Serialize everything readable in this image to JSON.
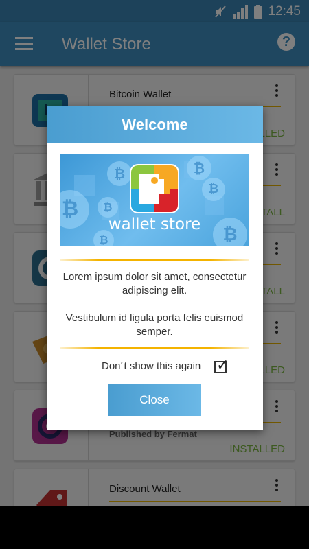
{
  "status_bar": {
    "time": "12:45"
  },
  "app_bar": {
    "title": "Wallet Store"
  },
  "wallets": [
    {
      "name": "Bitcoin Wallet",
      "publisher": "",
      "status": "INSTALLED",
      "icon": "bitcoin-wallet-icon",
      "color": "#1d8f8a"
    },
    {
      "name": "",
      "publisher": "",
      "status": "INSTALL",
      "icon": "bank-icon",
      "color": "#8a8a8a"
    },
    {
      "name": "",
      "publisher": "",
      "status": "INSTALL",
      "icon": "circle-wallet-icon",
      "color": "#2c6f8f"
    },
    {
      "name": "",
      "publisher": "",
      "status": "INSTALLED",
      "icon": "ticket-icon",
      "color": "#c88a2a"
    },
    {
      "name": "",
      "publisher": "Published by Fermat",
      "status": "INSTALLED",
      "icon": "fermat-icon",
      "color": "#b03090"
    },
    {
      "name": "Discount Wallet",
      "publisher": "",
      "status": "",
      "icon": "discount-tag-icon",
      "color": "#c03030"
    }
  ],
  "dialog": {
    "title": "Welcome",
    "banner_text": "wallet store",
    "paragraph1": "Lorem ipsum dolor sit amet, consectetur adipiscing elit.",
    "paragraph2": "Vestibulum id ligula porta felis euismod semper.",
    "dont_show_label": "Don´t show this again",
    "dont_show_checked": true,
    "close_label": "Close"
  }
}
